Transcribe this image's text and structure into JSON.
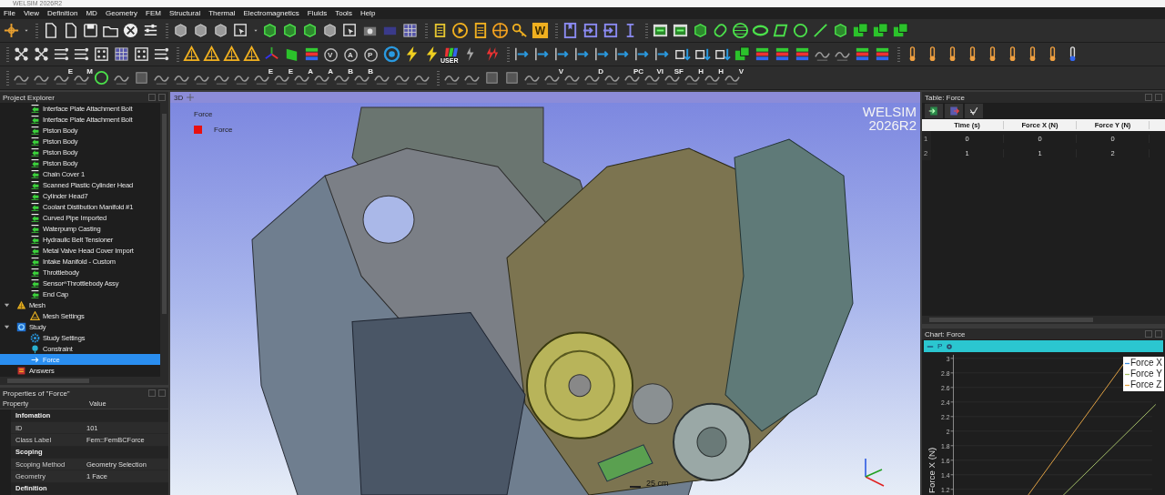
{
  "window": {
    "title": "WELSIM 2026R2"
  },
  "menu": [
    "File",
    "View",
    "Definition",
    "MD",
    "Geometry",
    "FEM",
    "Structural",
    "Thermal",
    "Electromagnetics",
    "Fluids",
    "Tools",
    "Help"
  ],
  "toolbars": [
    [
      {
        "kind": "cross"
      },
      {
        "kind": "caret"
      },
      {
        "kind": "sep"
      },
      {
        "kind": "doc"
      },
      {
        "kind": "doc"
      },
      {
        "kind": "save"
      },
      {
        "kind": "folder"
      },
      {
        "kind": "ball"
      },
      {
        "kind": "sliders"
      },
      {
        "kind": "sep"
      },
      {
        "kind": "cube"
      },
      {
        "kind": "cube"
      },
      {
        "kind": "cube"
      },
      {
        "kind": "cursor"
      },
      {
        "kind": "caret"
      },
      {
        "kind": "gcube"
      },
      {
        "kind": "gcube"
      },
      {
        "kind": "gcube"
      },
      {
        "kind": "cube"
      },
      {
        "kind": "cursor"
      },
      {
        "kind": "camera"
      },
      {
        "kind": "film"
      },
      {
        "kind": "grid"
      },
      {
        "kind": "sep"
      },
      {
        "kind": "scroll"
      },
      {
        "kind": "play"
      },
      {
        "kind": "page"
      },
      {
        "kind": "globe"
      },
      {
        "kind": "key"
      },
      {
        "kind": "letter",
        "label": "W"
      },
      {
        "kind": "sep"
      },
      {
        "kind": "bookmark"
      },
      {
        "kind": "arrowin"
      },
      {
        "kind": "arrowin"
      },
      {
        "kind": "ibeam"
      },
      {
        "kind": "sep"
      },
      {
        "kind": "panel"
      },
      {
        "kind": "panel"
      },
      {
        "kind": "gcube"
      },
      {
        "kind": "cylinder"
      },
      {
        "kind": "sphere"
      },
      {
        "kind": "ellipse"
      },
      {
        "kind": "para"
      },
      {
        "kind": "circle"
      },
      {
        "kind": "line"
      },
      {
        "kind": "gcube"
      },
      {
        "kind": "squares"
      },
      {
        "kind": "squares"
      },
      {
        "kind": "squares"
      }
    ],
    [
      {
        "kind": "sep"
      },
      {
        "kind": "nodes"
      },
      {
        "kind": "nodes"
      },
      {
        "kind": "flow"
      },
      {
        "kind": "flow"
      },
      {
        "kind": "dice"
      },
      {
        "kind": "grid"
      },
      {
        "kind": "dice"
      },
      {
        "kind": "flow"
      },
      {
        "kind": "sep"
      },
      {
        "kind": "tri"
      },
      {
        "kind": "tri"
      },
      {
        "kind": "tri"
      },
      {
        "kind": "tri"
      },
      {
        "kind": "axes"
      },
      {
        "kind": "plane"
      },
      {
        "kind": "stack"
      },
      {
        "kind": "cletter",
        "label": "V"
      },
      {
        "kind": "cletter",
        "label": "A"
      },
      {
        "kind": "cletter",
        "label": "P"
      },
      {
        "kind": "ring"
      },
      {
        "kind": "bolt"
      },
      {
        "kind": "bolt"
      },
      {
        "kind": "user",
        "label": "USER"
      },
      {
        "kind": "bolts"
      },
      {
        "kind": "rbolts"
      },
      {
        "kind": "sep"
      },
      {
        "kind": "barrow"
      },
      {
        "kind": "barrow"
      },
      {
        "kind": "barrow"
      },
      {
        "kind": "barrow"
      },
      {
        "kind": "barrow"
      },
      {
        "kind": "barrow"
      },
      {
        "kind": "barrow"
      },
      {
        "kind": "barrow"
      },
      {
        "kind": "sqarrow"
      },
      {
        "kind": "sqarrow"
      },
      {
        "kind": "sqarrow"
      },
      {
        "kind": "squares"
      },
      {
        "kind": "stack"
      },
      {
        "kind": "stack"
      },
      {
        "kind": "stack"
      },
      {
        "kind": "glyph"
      },
      {
        "kind": "glyph"
      },
      {
        "kind": "stack"
      },
      {
        "kind": "stack"
      },
      {
        "kind": "sep"
      },
      {
        "kind": "thermo"
      },
      {
        "kind": "thermo"
      },
      {
        "kind": "thermo"
      },
      {
        "kind": "thermo"
      },
      {
        "kind": "thermo"
      },
      {
        "kind": "thermo"
      },
      {
        "kind": "thermo"
      },
      {
        "kind": "thermo"
      },
      {
        "kind": "bthermo"
      }
    ],
    [
      {
        "kind": "sep"
      },
      {
        "kind": "glyph"
      },
      {
        "kind": "glyph"
      },
      {
        "kind": "glyph",
        "label": "E"
      },
      {
        "kind": "glyph",
        "label": "M"
      },
      {
        "kind": "circle"
      },
      {
        "kind": "glyph"
      },
      {
        "kind": "square"
      },
      {
        "kind": "glyph"
      },
      {
        "kind": "glyph"
      },
      {
        "kind": "glyph"
      },
      {
        "kind": "glyph"
      },
      {
        "kind": "glyph"
      },
      {
        "kind": "glyph",
        "label": "E"
      },
      {
        "kind": "glyph",
        "label": "E"
      },
      {
        "kind": "glyph",
        "label": "A"
      },
      {
        "kind": "glyph",
        "label": "A"
      },
      {
        "kind": "glyph",
        "label": "B"
      },
      {
        "kind": "glyph",
        "label": "B"
      },
      {
        "kind": "glyph"
      },
      {
        "kind": "glyph"
      },
      {
        "kind": "glyph"
      },
      {
        "kind": "sep"
      },
      {
        "kind": "glyph"
      },
      {
        "kind": "glyph"
      },
      {
        "kind": "square"
      },
      {
        "kind": "square"
      },
      {
        "kind": "glyph"
      },
      {
        "kind": "glyph",
        "label": "V"
      },
      {
        "kind": "glyph"
      },
      {
        "kind": "glyph",
        "label": "D"
      },
      {
        "kind": "glyph"
      },
      {
        "kind": "glyph",
        "label": "PC"
      },
      {
        "kind": "glyph",
        "label": "VI"
      },
      {
        "kind": "glyph",
        "label": "SF"
      },
      {
        "kind": "glyph",
        "label": "H"
      },
      {
        "kind": "glyph",
        "label": "H"
      },
      {
        "kind": "glyph",
        "label": "V"
      }
    ]
  ],
  "project_explorer": {
    "title": "Project Explorer",
    "tree": [
      {
        "children": [
          {
            "label": "Interface Plate Attachment Bolt",
            "kind": "body",
            "selected": false
          },
          {
            "label": "Interface Plate Attachment Bolt",
            "kind": "body",
            "selected": false
          },
          {
            "label": "Piston Body",
            "kind": "body",
            "selected": false
          },
          {
            "label": "Piston Body",
            "kind": "body",
            "selected": false
          },
          {
            "label": "Piston Body",
            "kind": "body",
            "selected": false
          },
          {
            "label": "Piston Body",
            "kind": "body",
            "selected": false
          },
          {
            "label": "Chain Cover 1",
            "kind": "body",
            "selected": false
          },
          {
            "label": "Scanned Plastic Cylinder Head",
            "kind": "body",
            "selected": false
          },
          {
            "label": "Cylinder Head7",
            "kind": "body",
            "selected": false
          },
          {
            "label": "Coolant Distibution Manifold #1",
            "kind": "body",
            "selected": false
          },
          {
            "label": "Curved Pipe Imported",
            "kind": "body",
            "selected": false
          },
          {
            "label": "Waterpump Casting",
            "kind": "body",
            "selected": false
          },
          {
            "label": "Hydraulic Belt Tensioner",
            "kind": "body",
            "selected": false
          },
          {
            "label": "Metal Valve Head Cover Import",
            "kind": "body",
            "selected": false
          },
          {
            "label": "Intake Manifold - Custom",
            "kind": "body",
            "selected": false
          },
          {
            "label": "Throttlebody",
            "kind": "body",
            "selected": false
          },
          {
            "label": "Sensor^Throttlebody Assy",
            "kind": "body",
            "selected": false
          },
          {
            "label": "End Cap",
            "kind": "body",
            "selected": false
          }
        ]
      },
      {
        "label": "Mesh",
        "kind": "mesh",
        "expanded": true,
        "selected": false,
        "children": [
          {
            "label": "Mesh Settings",
            "kind": "mesh-settings",
            "selected": false
          }
        ]
      },
      {
        "label": "Study",
        "kind": "study",
        "expanded": true,
        "selected": false,
        "children": [
          {
            "label": "Study Settings",
            "kind": "study-settings",
            "selected": false
          },
          {
            "label": "Constraint",
            "kind": "constraint",
            "selected": false
          },
          {
            "label": "Force",
            "kind": "force",
            "selected": true
          }
        ]
      },
      {
        "label": "Answers",
        "kind": "answers",
        "selected": false
      }
    ]
  },
  "properties": {
    "title": "Properties of \"Force\"",
    "columns": [
      "Property",
      "Value"
    ],
    "rows": [
      {
        "kind": "group",
        "label": "Infomation"
      },
      {
        "kind": "row",
        "property": "ID",
        "value": "101"
      },
      {
        "kind": "row",
        "property": "Class Label",
        "value": "Fem::FemBCForce"
      },
      {
        "kind": "group",
        "label": "Scoping"
      },
      {
        "kind": "row",
        "property": "Scoping Method",
        "value": "Geometry Selection"
      },
      {
        "kind": "row",
        "property": "Geometry",
        "value": "1 Face"
      },
      {
        "kind": "group",
        "label": "Definition"
      }
    ]
  },
  "viewport": {
    "tab": "3D",
    "title": "Force",
    "legend": [
      {
        "label": "Force",
        "color": "#e81010"
      }
    ],
    "logo": [
      "WELSIM",
      "2026R2"
    ],
    "scale": "25 cm"
  },
  "table_panel": {
    "title": "Table: Force",
    "columns": [
      "Time (s)",
      "Force X (N)",
      "Force Y (N)"
    ],
    "rows": [
      {
        "index": "1",
        "cells": [
          "0",
          "0",
          "0"
        ]
      },
      {
        "index": "2",
        "cells": [
          "1",
          "1",
          "2"
        ]
      }
    ]
  },
  "chart_panel": {
    "title": "Chart: Force",
    "toolbar_label": "P",
    "y_axis_title": "Force X (N)",
    "y_tick_labels": [
      "3",
      "2.8",
      "2.6",
      "2.4",
      "2.2",
      "2",
      "1.8",
      "1.6",
      "1.4",
      "1.2"
    ],
    "legend": [
      {
        "label": "Force X",
        "color": "#3f8fe0"
      },
      {
        "label": "Force Y",
        "color": "#a6c06a"
      },
      {
        "label": "Force Z",
        "color": "#e3a345"
      }
    ]
  }
}
